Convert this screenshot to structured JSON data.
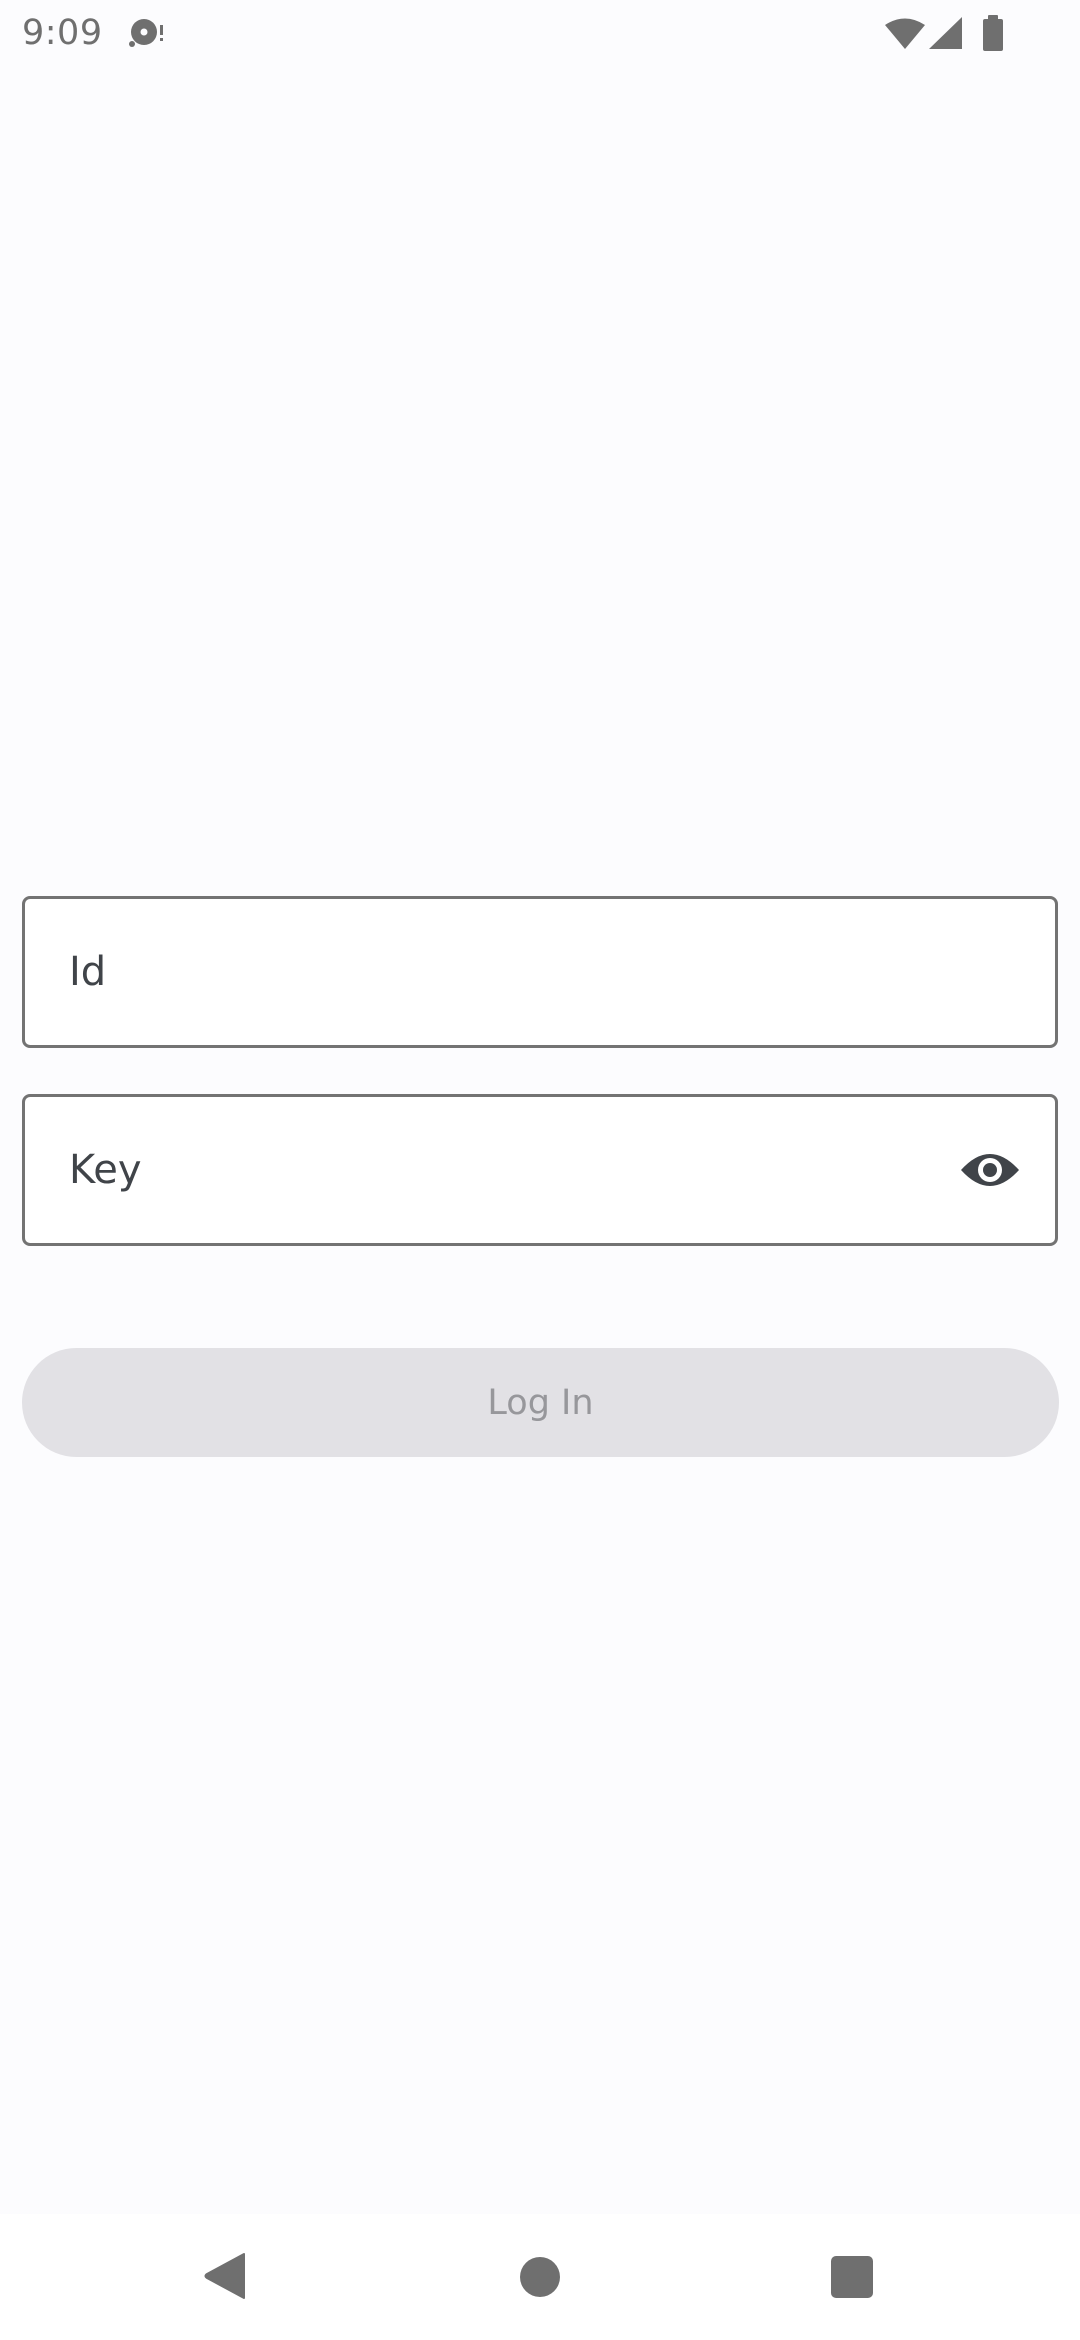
{
  "status_bar": {
    "time": "9:09",
    "icons": [
      "media-disc-icon",
      "wifi-icon",
      "signal-icon",
      "battery-icon"
    ]
  },
  "form": {
    "id_field": {
      "placeholder": "Id",
      "value": ""
    },
    "key_field": {
      "placeholder": "Key",
      "value": "",
      "trailing_icon": "eye-icon"
    },
    "login_button": {
      "label": "Log In",
      "enabled": false
    }
  },
  "nav_bar": {
    "icons": [
      "back-icon",
      "home-icon",
      "recents-icon"
    ]
  },
  "colors": {
    "background": "#fcfcfe",
    "field_border": "#737373",
    "field_text": "#404449",
    "button_disabled_bg": "#e2e1e5",
    "button_disabled_text": "#97979b",
    "system_icon": "#6f6f6f"
  }
}
